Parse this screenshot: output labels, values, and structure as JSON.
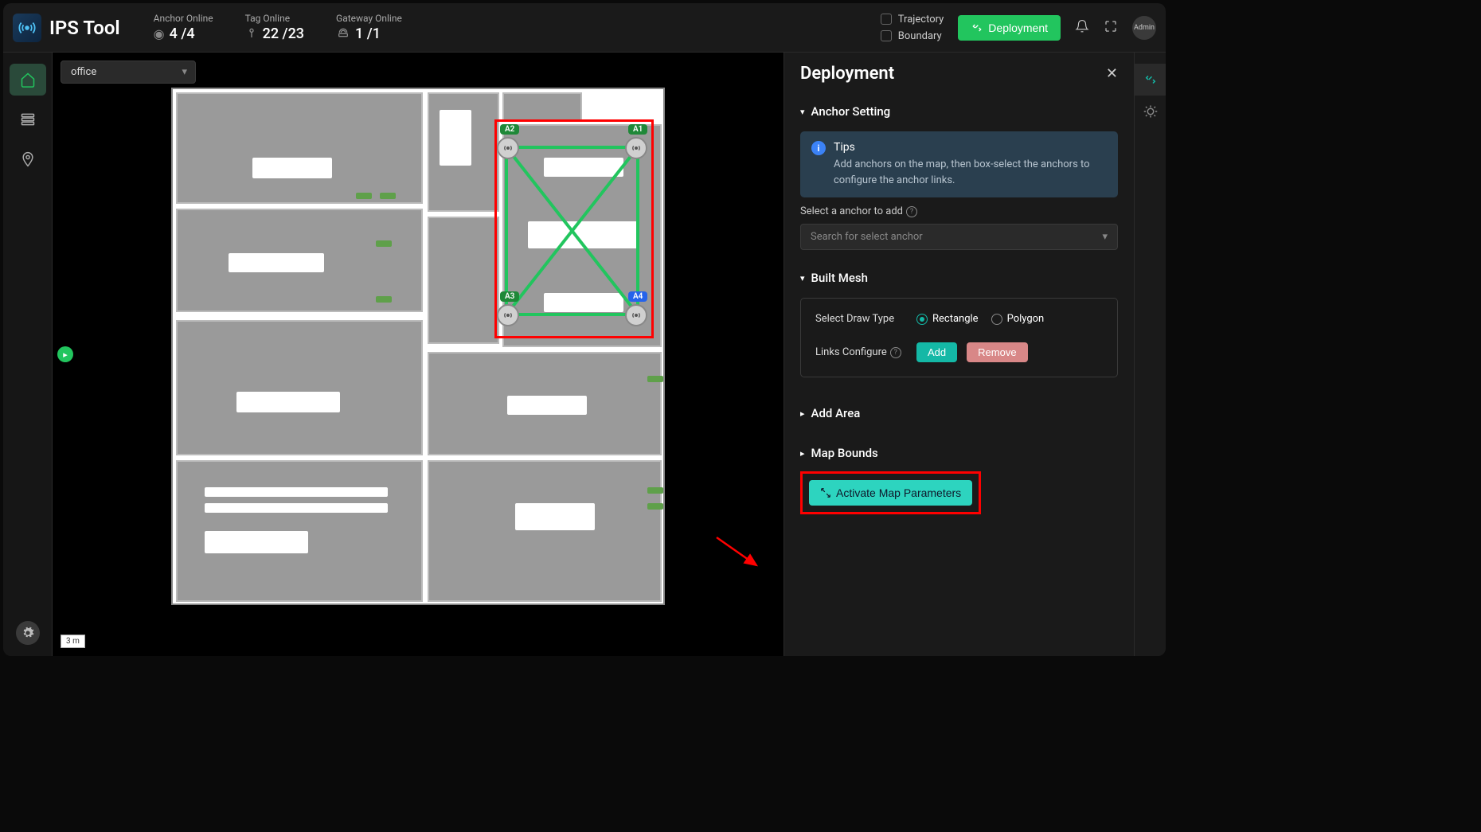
{
  "app": {
    "title": "IPS Tool"
  },
  "status": {
    "anchor": {
      "label": "Anchor Online",
      "value": "4 /4"
    },
    "tag": {
      "label": "Tag Online",
      "value": "22 /23"
    },
    "gateway": {
      "label": "Gateway Online",
      "value": "1 /1"
    }
  },
  "header": {
    "trajectory_label": "Trajectory",
    "boundary_label": "Boundary",
    "deployment_button": "Deployment",
    "avatar": "Admin"
  },
  "map": {
    "dropdown_value": "office",
    "scale": "3 m",
    "anchors": [
      "A1",
      "A2",
      "A3",
      "A4"
    ]
  },
  "panel": {
    "title": "Deployment",
    "anchor_setting": {
      "title": "Anchor Setting",
      "tips_title": "Tips",
      "tips_body": "Add anchors on the map, then box-select the anchors to configure the anchor links.",
      "select_label": "Select a anchor to add",
      "search_placeholder": "Search for select anchor"
    },
    "built_mesh": {
      "title": "Built Mesh",
      "draw_type_label": "Select Draw Type",
      "rectangle": "Rectangle",
      "polygon": "Polygon",
      "links_label": "Links Configure",
      "add": "Add",
      "remove": "Remove"
    },
    "add_area": {
      "title": "Add Area"
    },
    "map_bounds": {
      "title": "Map Bounds"
    },
    "activate_button": "Activate Map Parameters"
  }
}
